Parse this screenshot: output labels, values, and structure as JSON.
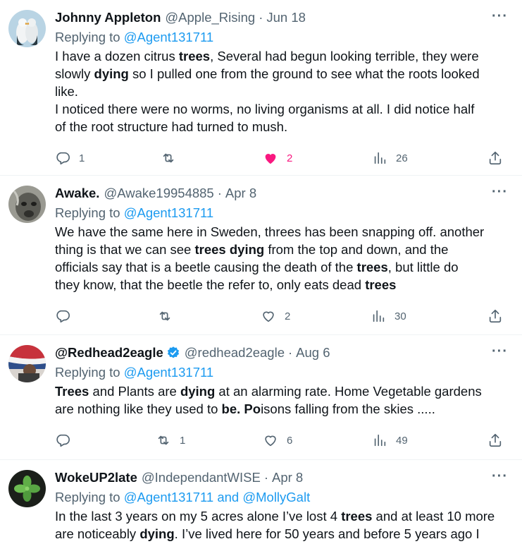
{
  "tweets": [
    {
      "name": "Johnny Appleton",
      "handle": "@Apple_Rising",
      "date": "Jun 18",
      "reply_prefix": "Replying to ",
      "reply_to": "@Agent131711",
      "body": [
        {
          "t": "I have a dozen citrus "
        },
        {
          "b": "trees"
        },
        {
          "t": ", Several had begun looking terrible, they were\nslowly "
        },
        {
          "b": "dying"
        },
        {
          "t": " so I pulled one from the ground to see what the roots looked\nlike.\n I noticed there were no worms, no living organisms at all. I did notice half\nof the root structure had turned to mush."
        }
      ],
      "replies": "1",
      "retweets": "",
      "likes": "2",
      "liked": true,
      "views": "26",
      "avatar_colors": [
        "#a9c6d8",
        "#e9eef1",
        "#2b3a42"
      ]
    },
    {
      "name": "Awake.",
      "handle": "@Awake19954885",
      "date": "Apr 8",
      "reply_prefix": "Replying to ",
      "reply_to": "@Agent131711",
      "body": [
        {
          "t": "We have the same here in Sweden, threes has been snapping off. another\nthing is that we can see "
        },
        {
          "b": "trees dying"
        },
        {
          "t": " from the top and down, and the\nofficials say that is a beetle causing the death of the "
        },
        {
          "b": "trees"
        },
        {
          "t": ", but little do\nthey know, that the beetle the refer to, only eats dead "
        },
        {
          "b": "trees"
        }
      ],
      "replies": "",
      "retweets": "",
      "likes": "2",
      "liked": false,
      "views": "30",
      "avatar_colors": [
        "#8d8d86",
        "#c9c9c2",
        "#3a3a36"
      ]
    },
    {
      "name": "@Redhead2eagle",
      "handle": "@redhead2eagle",
      "date": "Aug 6",
      "verified": true,
      "reply_prefix": "Replying to ",
      "reply_to": "@Agent131711",
      "body": [
        {
          "b": "Trees"
        },
        {
          "t": " and Plants are "
        },
        {
          "b": "dying"
        },
        {
          "t": " at an alarming rate.  Home Vegetable gardens\nare nothing like they used to "
        },
        {
          "b": "be.  Po"
        },
        {
          "t": "isons falling from the skies ....."
        }
      ],
      "replies": "",
      "retweets": "1",
      "likes": "6",
      "liked": false,
      "views": "49",
      "avatar_colors": [
        "#cf2f3a",
        "#2e4e8a",
        "#3b3b3b"
      ]
    },
    {
      "name": "WokeUP2late",
      "handle": "@IndependantWISE",
      "date": "Apr 8",
      "reply_prefix": "Replying to ",
      "reply_to": "@Agent131711 and @MollyGalt",
      "body": [
        {
          "t": "In the last 3 years on my 5 acres alone I’ve lost 4 "
        },
        {
          "b": "trees"
        },
        {
          "t": " and at least 10 more\nare noticeably "
        },
        {
          "b": "dying"
        },
        {
          "t": ". I’ve lived here for 50 years and before 5 years ago I"
        }
      ],
      "avatar_colors": [
        "#1b1f1a",
        "#4f9a3d",
        "#8bd36a"
      ]
    }
  ],
  "icons": {
    "more": "more-dots-icon",
    "reply": "reply-icon",
    "retweet": "retweet-icon",
    "like": "heart-icon",
    "views": "views-icon",
    "share": "share-icon"
  },
  "colors": {
    "link": "#1d9bf0",
    "like": "#f91880",
    "muted": "#536471",
    "text": "#0f1419"
  }
}
